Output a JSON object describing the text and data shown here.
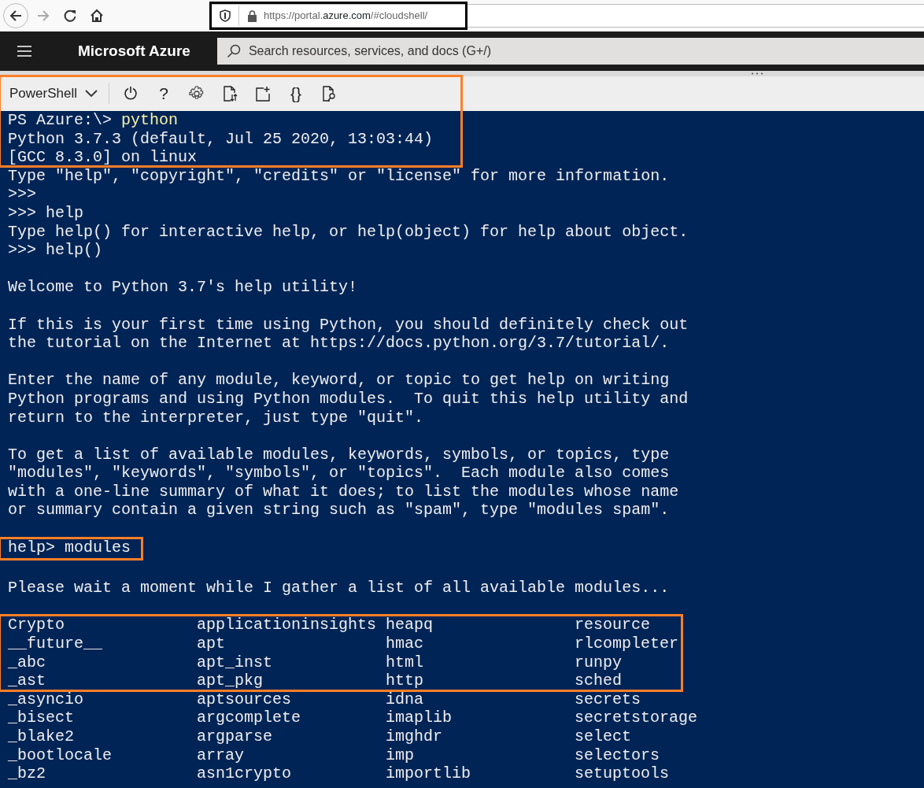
{
  "browser": {
    "back_disabled": false,
    "forward_disabled": true,
    "url": {
      "prefix": "https://portal.",
      "domain": "azure.com",
      "suffix": "/#cloudshell/"
    },
    "url_highlighted": true
  },
  "portal": {
    "title": "Microsoft Azure",
    "search": {
      "placeholder": "Search resources, services, and docs (G+/)"
    }
  },
  "shell": {
    "selector": "PowerShell",
    "tools": [
      {
        "kind": "power"
      },
      {
        "kind": "text",
        "label": "?"
      },
      {
        "kind": "gear"
      },
      {
        "kind": "transfer"
      },
      {
        "kind": "newfile"
      },
      {
        "kind": "text",
        "label": "{}"
      },
      {
        "kind": "preview"
      }
    ],
    "header_highlighted": true
  },
  "terminal": {
    "blocks": [
      {
        "kind": "lines",
        "lines": [
          {
            "kind": "prompt",
            "prompt": "PS Azure:\\>",
            "command": "python"
          },
          {
            "kind": "output",
            "text": "Python 3.7.3 (default, Jul 25 2020, 13:03:44)"
          },
          {
            "kind": "output",
            "text": "[GCC 8.3.0] on linux"
          }
        ]
      },
      {
        "kind": "lines",
        "highlighted": false,
        "lines": [
          {
            "kind": "output",
            "text": "Type \"help\", \"copyright\", \"credits\" or \"license\" for more information."
          },
          {
            "kind": "output",
            "text": ">>>"
          },
          {
            "kind": "output",
            "text": ">>> help"
          },
          {
            "kind": "output",
            "text": "Type help() for interactive help, or help(object) for help about object."
          },
          {
            "kind": "output",
            "text": ">>> help()"
          },
          {
            "kind": "blank"
          },
          {
            "kind": "output",
            "text": "Welcome to Python 3.7's help utility!"
          },
          {
            "kind": "blank"
          },
          {
            "kind": "output",
            "text": "If this is your first time using Python, you should definitely check out"
          },
          {
            "kind": "output",
            "text": "the tutorial on the Internet at https://docs.python.org/3.7/tutorial/."
          },
          {
            "kind": "blank"
          },
          {
            "kind": "output",
            "text": "Enter the name of any module, keyword, or topic to get help on writing"
          },
          {
            "kind": "output",
            "text": "Python programs and using Python modules.  To quit this help utility and"
          },
          {
            "kind": "output",
            "text": "return to the interpreter, just type \"quit\"."
          },
          {
            "kind": "blank"
          },
          {
            "kind": "output",
            "text": "To get a list of available modules, keywords, symbols, or topics, type"
          },
          {
            "kind": "output",
            "text": "\"modules\", \"keywords\", \"symbols\", or \"topics\".  Each module also comes"
          },
          {
            "kind": "output",
            "text": "with a one-line summary of what it does; to list the modules whose name"
          },
          {
            "kind": "output",
            "text": "or summary contain a given string such as \"spam\", type \"modules spam\"."
          },
          {
            "kind": "blank"
          }
        ]
      },
      {
        "kind": "lines",
        "highlighted": true,
        "lines": [
          {
            "kind": "output",
            "text": "help> modules"
          }
        ]
      },
      {
        "kind": "lines",
        "highlighted": false,
        "lines": [
          {
            "kind": "blank"
          },
          {
            "kind": "output",
            "text": "Please wait a moment while I gather a list of all available modules..."
          },
          {
            "kind": "blank"
          }
        ]
      },
      {
        "kind": "table",
        "highlighted": true,
        "rows": [
          [
            "Crypto",
            "applicationinsights",
            "heapq",
            "resource"
          ],
          [
            "__future__",
            "apt",
            "hmac",
            "rlcompleter"
          ],
          [
            "_abc",
            "apt_inst",
            "html",
            "runpy"
          ],
          [
            "_ast",
            "apt_pkg",
            "http",
            "sched"
          ]
        ]
      },
      {
        "kind": "table",
        "highlighted": false,
        "rows": [
          [
            "_asyncio",
            "aptsources",
            "idna",
            "secrets"
          ],
          [
            "_bisect",
            "argcomplete",
            "imaplib",
            "secretstorage"
          ],
          [
            "_blake2",
            "argparse",
            "imghdr",
            "select"
          ],
          [
            "_bootlocale",
            "array",
            "imp",
            "selectors"
          ],
          [
            "_bz2",
            "asn1crypto",
            "importlib",
            "setuptools"
          ]
        ]
      }
    ]
  }
}
